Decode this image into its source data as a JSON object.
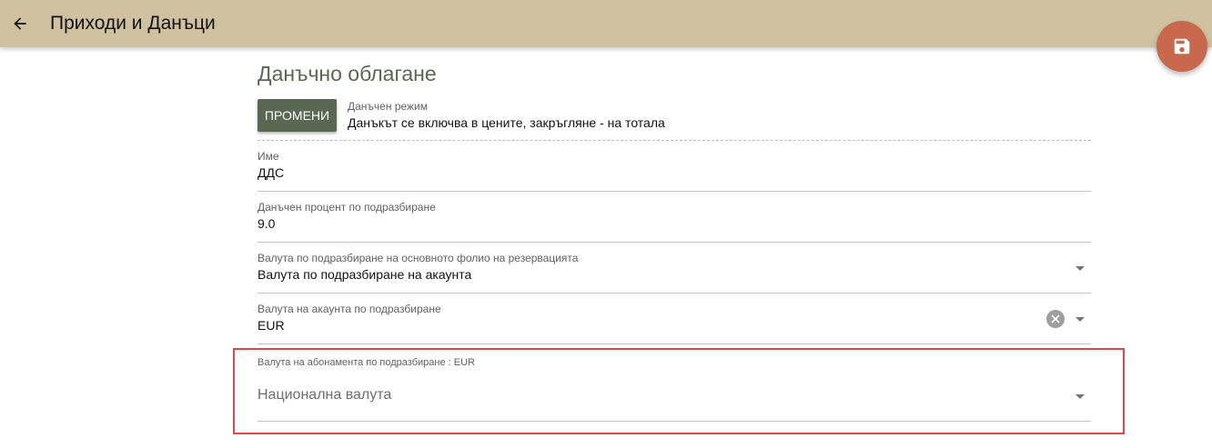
{
  "app": {
    "title": "Приходи и Данъци"
  },
  "section": {
    "title": "Данъчно облагане"
  },
  "tax_mode": {
    "button_label": "ПРОМЕНИ",
    "label": "Данъчен режим",
    "value": "Данъкът се включва в цените,  закръгляне - на тотала"
  },
  "fields": {
    "name": {
      "label": "Име",
      "value": "ДДС"
    },
    "default_rate": {
      "label": "Данъчен процент по подразбиране",
      "value": "9.0"
    },
    "folio_currency": {
      "label": "Валута по подразбиране на основното фолио на резервацията",
      "value": "Валута по подразбиране на акаунта"
    },
    "account_currency": {
      "label": "Валута на акаунта по подразбиране",
      "value": "EUR"
    },
    "subscription_currency": {
      "label": "Валута на абонамента по подразбиране : EUR",
      "value": "Национална валута"
    }
  },
  "icons": {
    "back": "arrow-left-icon",
    "save": "save-icon",
    "clear": "clear-circle-icon",
    "dropdown": "chevron-down-icon"
  },
  "colors": {
    "appbar": "#d0c2a0",
    "fab": "#c8684c",
    "accent": "#5a6752",
    "highlight": "#e0464a"
  }
}
